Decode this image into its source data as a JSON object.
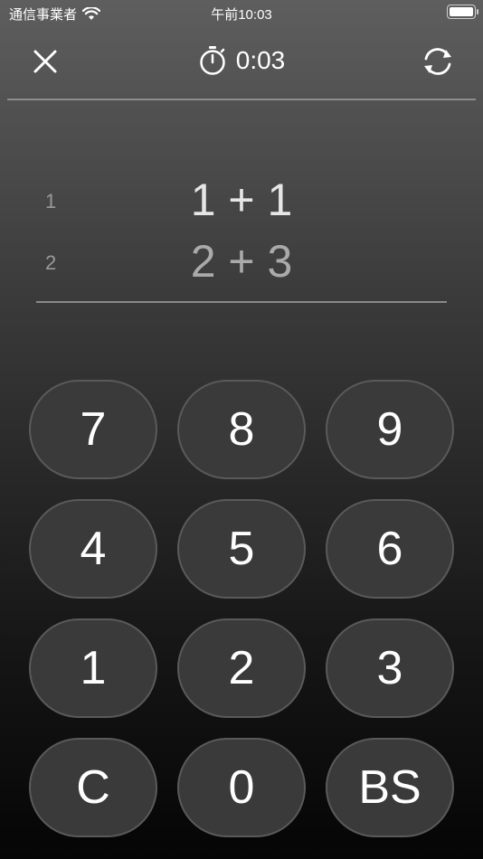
{
  "status_bar": {
    "carrier": "通信事業者",
    "time": "午前10:03"
  },
  "top_bar": {
    "timer": "0:03"
  },
  "problems": [
    {
      "number": "1",
      "expression": "1 + 1"
    },
    {
      "number": "2",
      "expression": "2 + 3"
    }
  ],
  "keypad": {
    "k7": "7",
    "k8": "8",
    "k9": "9",
    "k4": "4",
    "k5": "5",
    "k6": "6",
    "k1": "1",
    "k2": "2",
    "k3": "3",
    "clear": "C",
    "k0": "0",
    "backspace": "BS"
  }
}
